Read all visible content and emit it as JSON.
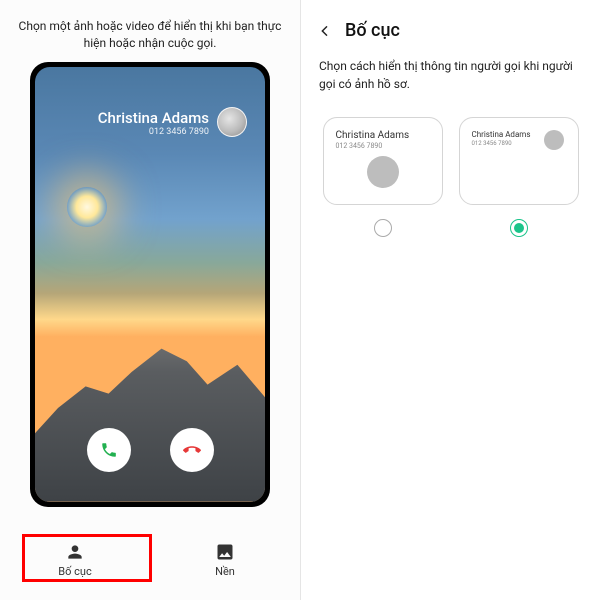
{
  "left": {
    "description": "Chọn một ảnh hoặc video để hiển thị khi bạn thực hiện hoặc nhận cuộc gọi.",
    "caller": {
      "name": "Christina Adams",
      "phone": "012 3456 7890"
    },
    "tabs": {
      "layout": "Bố cục",
      "background": "Nền"
    }
  },
  "right": {
    "title": "Bố cục",
    "description": "Chọn cách hiển thị thông tin người gọi khi người gọi có ảnh hồ sơ.",
    "sample": {
      "name": "Christina Adams",
      "phone": "012 3456 7890"
    }
  }
}
